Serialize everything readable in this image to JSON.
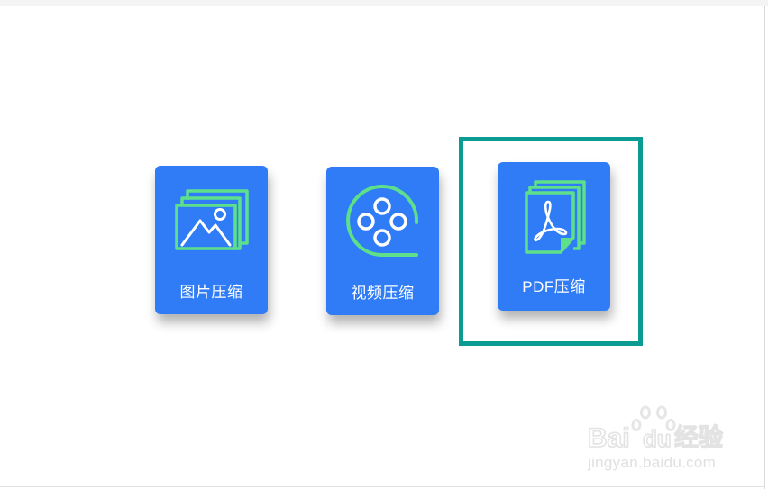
{
  "cards": [
    {
      "id": "image",
      "label": "图片压缩",
      "icon": "image-stack-icon"
    },
    {
      "id": "video",
      "label": "视频压缩",
      "icon": "film-reel-icon"
    },
    {
      "id": "pdf",
      "label": "PDF压缩",
      "icon": "pdf-file-icon"
    }
  ],
  "watermark": {
    "brand": "Bai",
    "brand_suffix": "du",
    "brand_cn": "经验",
    "url": "jingyan.baidu.com"
  },
  "colors": {
    "card_bg": "#2f7cf6",
    "icon_green": "#5ee08a",
    "highlight": "#0a9b92",
    "label_text": "#ffffff"
  }
}
